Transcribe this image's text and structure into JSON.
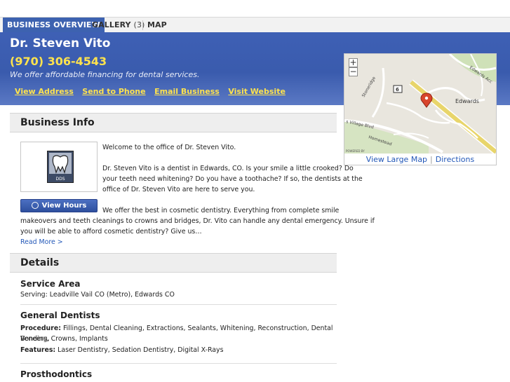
{
  "tabs": {
    "overview": "BUSINESS OVERVIEW",
    "gallery": "GALLERY",
    "gallery_count": "(3)",
    "map": "MAP"
  },
  "business": {
    "name": "Dr. Steven Vito",
    "phone": "(970) 306-4543",
    "tagline": "We offer affordable financing for dental services.",
    "actions": {
      "view_address": "View Address",
      "send_to_phone": "Send to Phone",
      "email_business": "Email Business",
      "visit_website": "Visit Website"
    }
  },
  "map": {
    "zoom_in": "+",
    "zoom_out": "−",
    "labels": {
      "town": "Edwards",
      "road_edwards_access": "Edwards Acc",
      "road_stoneridge": "Stoneridge",
      "road_village": "s Village Blvd",
      "road_homestead": "Homestead",
      "highway": "6",
      "powered": "POWERED BY"
    },
    "view_large": "View Large Map",
    "directions": "Directions",
    "link_sep": "|"
  },
  "business_info": {
    "heading": "Business Info",
    "logo_text": "DDS",
    "view_hours": "View Hours",
    "paragraph1": "Welcome to the office of Dr. Steven Vito.",
    "paragraph2_lines": [
      "Dr. Steven Vito is a dentist in Edwards, CO. Is your smile a little crooked? Do",
      "your teeth need whitening? Do you have a toothache? If so, the dentists at the",
      "office of Dr. Steven Vito are here to serve you."
    ],
    "paragraph3_first": "We offer the best in cosmetic dentistry. Everything from complete smile",
    "paragraph3_lines": [
      "makeovers and teeth cleanings to crowns and bridges, Dr. Vito can handle any dental emergency. Unsure if",
      "you will be able to afford cosmetic dentistry? Give us…"
    ],
    "read_more": "Read More >"
  },
  "details": {
    "heading": "Details",
    "service_area": {
      "title": "Service Area",
      "text": "Serving: Leadville Vail CO (Metro), Edwards CO"
    },
    "general": {
      "title": "General Dentists",
      "procedure_label": "Procedure:",
      "procedure_line1": "Fillings, Dental Cleaning, Extractions, Sealants, Whitening, Reconstruction, Dental Bonding,",
      "procedure_line2": "Veneers, Crowns, Implants",
      "features_label": "Features:",
      "features_text": "Laser Dentistry, Sedation Dentistry, Digital X-Rays"
    },
    "prosthodontics": {
      "title": "Prosthodontics"
    }
  },
  "colors": {
    "header_blue": "#3a5bad",
    "phone_yellow": "#ffe34d",
    "link_blue": "#2358b8"
  }
}
